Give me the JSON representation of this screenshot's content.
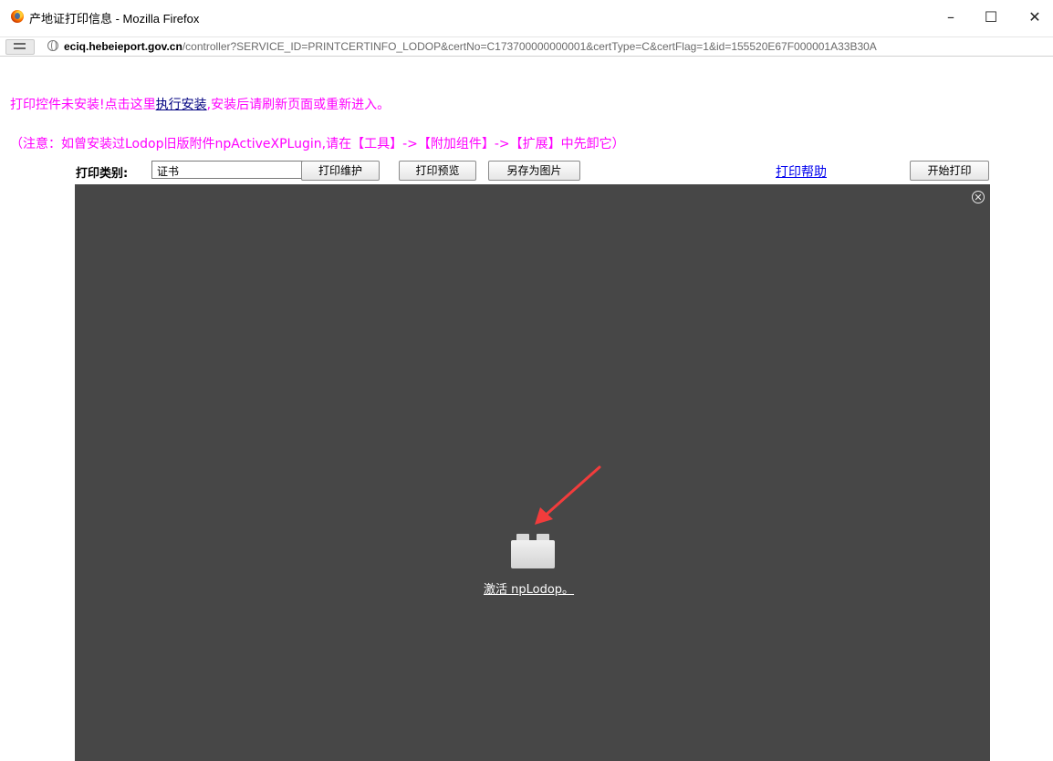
{
  "window": {
    "title": "产地证打印信息 - Mozilla Firefox",
    "minimize": "–",
    "maximize": "☐",
    "close": "✕"
  },
  "address": {
    "url_domain": "eciq.hebeieport.gov.cn",
    "url_prefix": "",
    "url_path": "/controller?SERVICE_ID=PRINTCERTINFO_LODOP&certNo=C173700000000001&certType=C&certFlag=1&id=155520E67F000001A33B30A"
  },
  "notice": {
    "line1_before": "打印控件未安装!点击这里",
    "line1_link": "执行安装",
    "line1_after": ",安装后请刷新页面或重新进入。",
    "line2": "（注意：如曾安装过Lodop旧版附件npActiveXPLugin,请在【工具】->【附加组件】->【扩展】中先卸它）"
  },
  "toolbar": {
    "print_type_label": "打印类别:",
    "print_type_value": "证书",
    "btn_maintenance": "打印维护",
    "btn_preview": "打印预览",
    "btn_save_image": "另存为图片",
    "help_link": "打印帮助",
    "btn_start_print": "开始打印"
  },
  "plugin": {
    "activate_text": "激活 npLodop。"
  },
  "icons": {
    "app": "firefox-icon",
    "identity": "page-info-icon",
    "globe": "globe-icon",
    "plugin": "plugin-brick-icon",
    "close": "close-circle-icon",
    "arrow": "annotation-arrow-icon"
  },
  "colors": {
    "notice": "#ff00ff",
    "install_link": "#000080",
    "help_link": "#0000ee",
    "plugin_bg": "#474747",
    "annotation_arrow": "#f23c3c"
  }
}
